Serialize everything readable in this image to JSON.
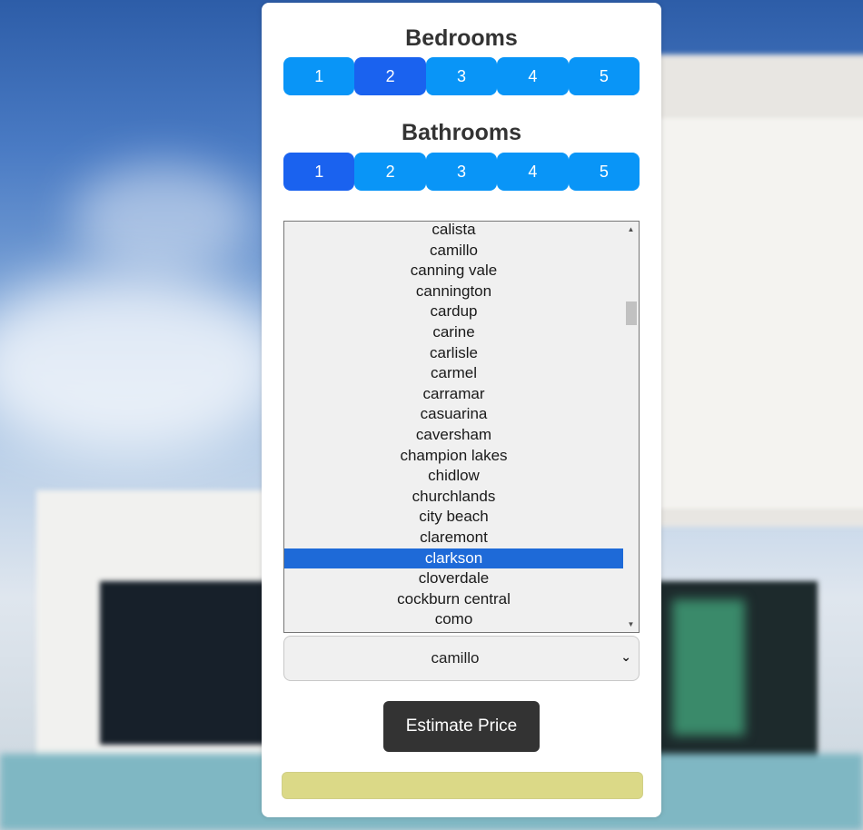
{
  "bedrooms": {
    "title": "Bedrooms",
    "options": [
      "1",
      "2",
      "3",
      "4",
      "5"
    ],
    "selected": "2"
  },
  "bathrooms": {
    "title": "Bathrooms",
    "options": [
      "1",
      "2",
      "3",
      "4",
      "5"
    ],
    "selected": "1"
  },
  "suburb_select": {
    "value": "camillo",
    "dropdown_options": [
      "calista",
      "camillo",
      "canning vale",
      "cannington",
      "cardup",
      "carine",
      "carlisle",
      "carmel",
      "carramar",
      "casuarina",
      "caversham",
      "champion lakes",
      "chidlow",
      "churchlands",
      "city beach",
      "claremont",
      "clarkson",
      "cloverdale",
      "cockburn central",
      "como"
    ],
    "highlighted": "clarkson"
  },
  "estimate_button": {
    "label": "Estimate Price"
  },
  "result": {
    "text": ""
  },
  "colors": {
    "button_blue": "#0995f7",
    "button_active": "#1a62ef",
    "highlight": "#1e6ad8",
    "estimate_bg": "#333333",
    "result_bg": "#dbd987"
  }
}
